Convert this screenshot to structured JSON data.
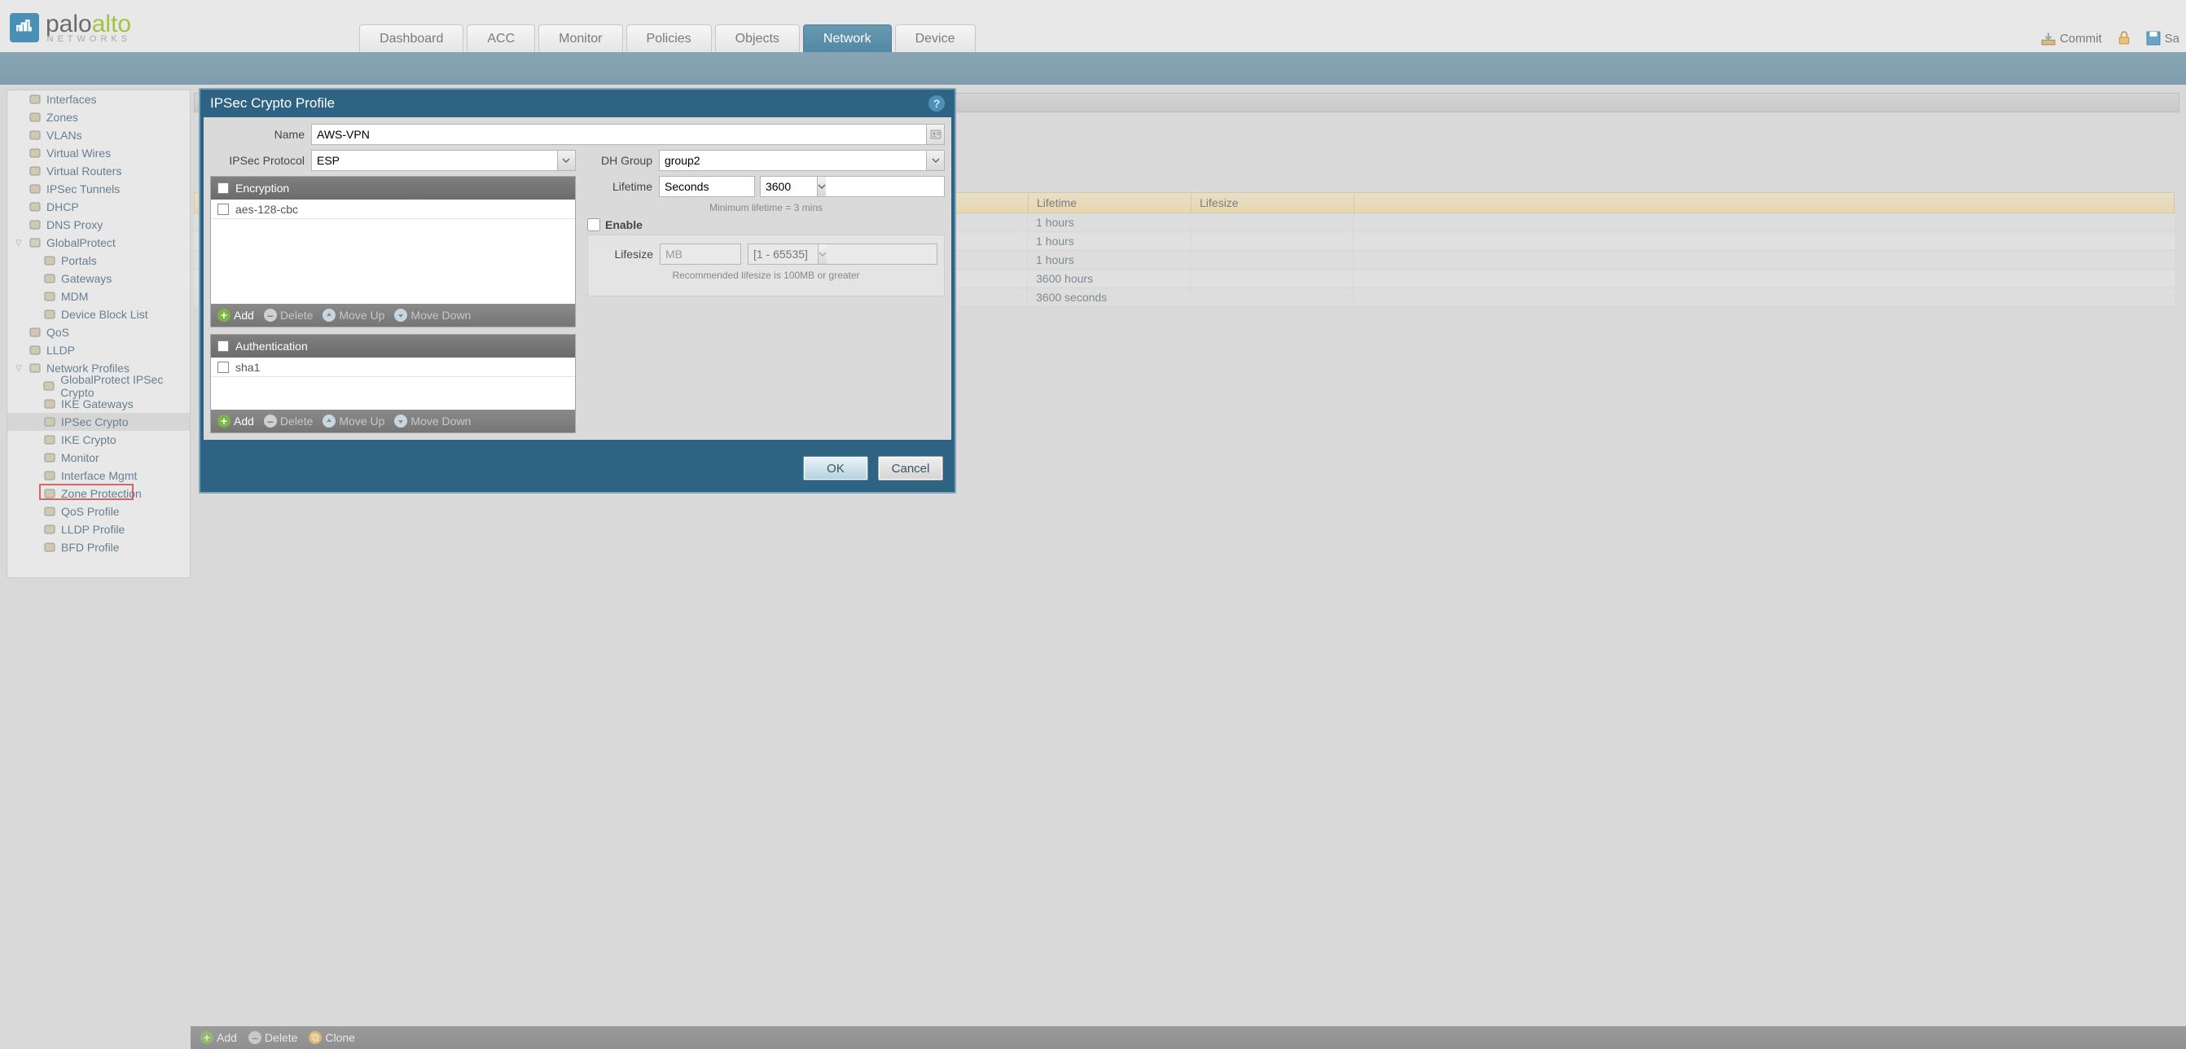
{
  "logo": {
    "brand": "paloalto",
    "sub": "NETWORKS"
  },
  "tabs": [
    "Dashboard",
    "ACC",
    "Monitor",
    "Policies",
    "Objects",
    "Network",
    "Device"
  ],
  "active_tab_index": 5,
  "top_right": {
    "commit": "Commit",
    "save": "Sa"
  },
  "sidebar": {
    "items": [
      {
        "label": "Interfaces"
      },
      {
        "label": "Zones"
      },
      {
        "label": "VLANs"
      },
      {
        "label": "Virtual Wires"
      },
      {
        "label": "Virtual Routers"
      },
      {
        "label": "IPSec Tunnels"
      },
      {
        "label": "DHCP"
      },
      {
        "label": "DNS Proxy"
      },
      {
        "label": "GlobalProtect",
        "expandable": true,
        "expanded": true,
        "children": [
          {
            "label": "Portals"
          },
          {
            "label": "Gateways"
          },
          {
            "label": "MDM"
          },
          {
            "label": "Device Block List"
          }
        ]
      },
      {
        "label": "QoS"
      },
      {
        "label": "LLDP"
      },
      {
        "label": "Network Profiles",
        "expandable": true,
        "expanded": true,
        "children": [
          {
            "label": "GlobalProtect IPSec Crypto"
          },
          {
            "label": "IKE Gateways"
          },
          {
            "label": "IPSec Crypto",
            "selected": true
          },
          {
            "label": "IKE Crypto"
          },
          {
            "label": "Monitor"
          },
          {
            "label": "Interface Mgmt"
          },
          {
            "label": "Zone Protection"
          },
          {
            "label": "QoS Profile"
          },
          {
            "label": "LLDP Profile"
          },
          {
            "label": "BFD Profile"
          }
        ]
      }
    ]
  },
  "grid": {
    "headers": [
      "Lifetime",
      "Lifesize"
    ],
    "rows": [
      {
        "lifetime": "1 hours",
        "lifesize": ""
      },
      {
        "lifetime": "1 hours",
        "lifesize": ""
      },
      {
        "lifetime": "1 hours",
        "lifesize": ""
      },
      {
        "lifetime": "3600 hours",
        "lifesize": ""
      },
      {
        "lifetime": "3600 seconds",
        "lifesize": ""
      }
    ]
  },
  "footer": {
    "add": "Add",
    "delete": "Delete",
    "clone": "Clone"
  },
  "dialog": {
    "title": "IPSec Crypto Profile",
    "name_label": "Name",
    "name_value": "AWS-VPN",
    "protocol_label": "IPSec Protocol",
    "protocol_value": "ESP",
    "dh_label": "DH Group",
    "dh_value": "group2",
    "lifetime_label": "Lifetime",
    "lifetime_unit": "Seconds",
    "lifetime_value": "3600",
    "lifetime_hint": "Minimum lifetime = 3 mins",
    "enable_label": "Enable",
    "lifesize_label": "Lifesize",
    "lifesize_unit": "MB",
    "lifesize_placeholder": "[1 - 65535]",
    "lifesize_hint": "Recommended lifesize is 100MB or greater",
    "enc_header": "Encryption",
    "enc_rows": [
      "aes-128-cbc"
    ],
    "auth_header": "Authentication",
    "auth_rows": [
      "sha1"
    ],
    "list_actions": {
      "add": "Add",
      "delete": "Delete",
      "up": "Move Up",
      "down": "Move Down"
    },
    "ok": "OK",
    "cancel": "Cancel"
  }
}
